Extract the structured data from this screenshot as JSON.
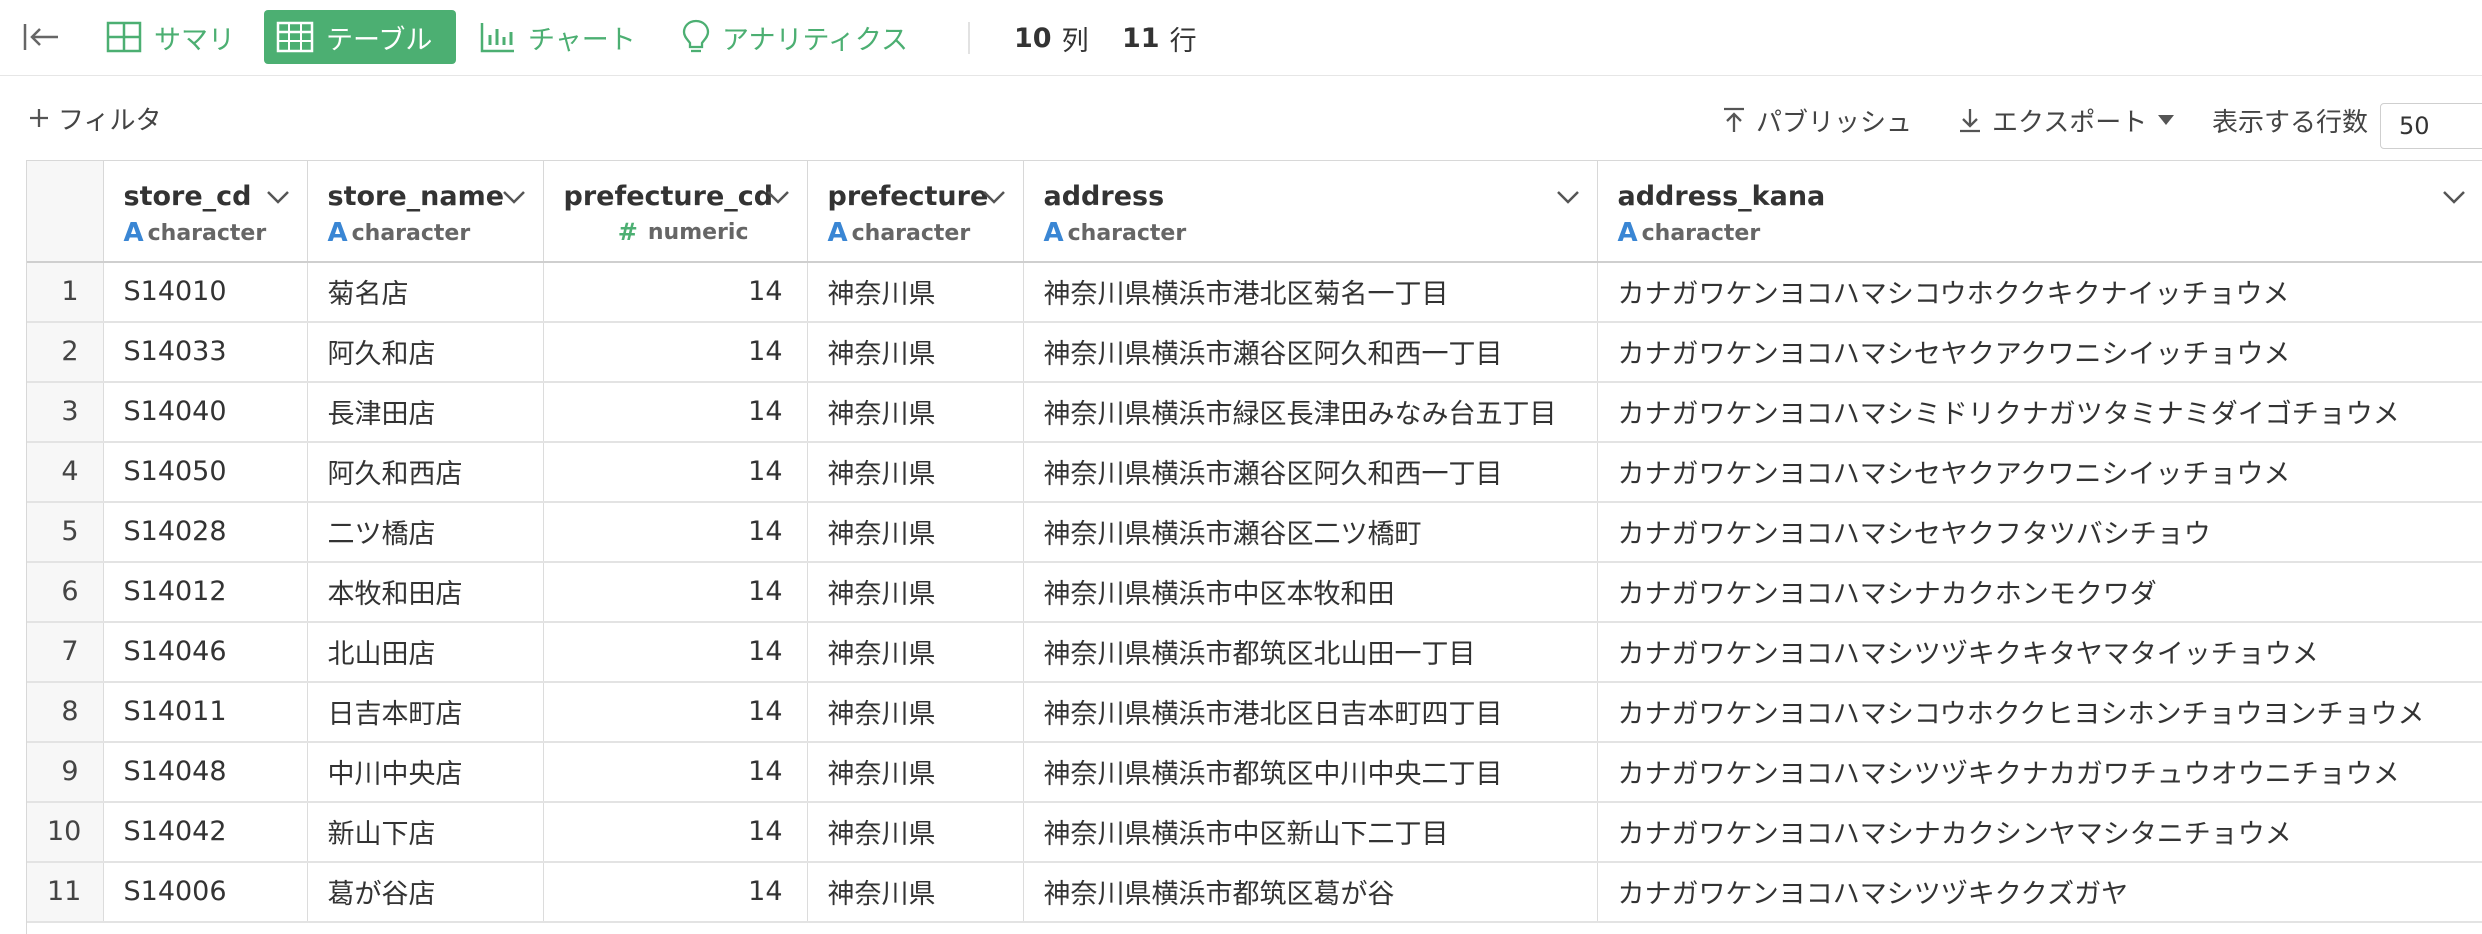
{
  "toolbar": {
    "tabs": [
      {
        "label": "サマリ",
        "icon": "grid-icon"
      },
      {
        "label": "テーブル",
        "icon": "table-icon",
        "active": true
      },
      {
        "label": "チャート",
        "icon": "bar-chart-icon"
      },
      {
        "label": "アナリティクス",
        "icon": "lightbulb-icon"
      }
    ],
    "columns_count": "10",
    "columns_unit": "列",
    "rows_count": "11",
    "rows_unit": "行"
  },
  "subbar": {
    "filter_label": "フィルタ",
    "publish_label": "パブリッシュ",
    "export_label": "エクスポート",
    "rows_display_label": "表示する行数",
    "rows_display_value": "50"
  },
  "table": {
    "columns": [
      {
        "name": "store_cd",
        "type": "character"
      },
      {
        "name": "store_name",
        "type": "character"
      },
      {
        "name": "prefecture_cd",
        "type": "numeric"
      },
      {
        "name": "prefecture",
        "type": "character"
      },
      {
        "name": "address",
        "type": "character"
      },
      {
        "name": "address_kana",
        "type": "character"
      }
    ],
    "rows": [
      {
        "idx": "1",
        "store_cd": "S14010",
        "store_name": "菊名店",
        "prefecture_cd": "14",
        "prefecture": "神奈川県",
        "address": "神奈川県横浜市港北区菊名一丁目",
        "address_kana": "カナガワケンヨコハマシコウホククキクナイッチョウメ"
      },
      {
        "idx": "2",
        "store_cd": "S14033",
        "store_name": "阿久和店",
        "prefecture_cd": "14",
        "prefecture": "神奈川県",
        "address": "神奈川県横浜市瀬谷区阿久和西一丁目",
        "address_kana": "カナガワケンヨコハマシセヤクアクワニシイッチョウメ"
      },
      {
        "idx": "3",
        "store_cd": "S14040",
        "store_name": "長津田店",
        "prefecture_cd": "14",
        "prefecture": "神奈川県",
        "address": "神奈川県横浜市緑区長津田みなみ台五丁目",
        "address_kana": "カナガワケンヨコハマシミドリクナガツタミナミダイゴチョウメ"
      },
      {
        "idx": "4",
        "store_cd": "S14050",
        "store_name": "阿久和西店",
        "prefecture_cd": "14",
        "prefecture": "神奈川県",
        "address": "神奈川県横浜市瀬谷区阿久和西一丁目",
        "address_kana": "カナガワケンヨコハマシセヤクアクワニシイッチョウメ"
      },
      {
        "idx": "5",
        "store_cd": "S14028",
        "store_name": "二ツ橋店",
        "prefecture_cd": "14",
        "prefecture": "神奈川県",
        "address": "神奈川県横浜市瀬谷区二ツ橋町",
        "address_kana": "カナガワケンヨコハマシセヤクフタツバシチョウ"
      },
      {
        "idx": "6",
        "store_cd": "S14012",
        "store_name": "本牧和田店",
        "prefecture_cd": "14",
        "prefecture": "神奈川県",
        "address": "神奈川県横浜市中区本牧和田",
        "address_kana": "カナガワケンヨコハマシナカクホンモクワダ"
      },
      {
        "idx": "7",
        "store_cd": "S14046",
        "store_name": "北山田店",
        "prefecture_cd": "14",
        "prefecture": "神奈川県",
        "address": "神奈川県横浜市都筑区北山田一丁目",
        "address_kana": "カナガワケンヨコハマシツヅキクキタヤマタイッチョウメ"
      },
      {
        "idx": "8",
        "store_cd": "S14011",
        "store_name": "日吉本町店",
        "prefecture_cd": "14",
        "prefecture": "神奈川県",
        "address": "神奈川県横浜市港北区日吉本町四丁目",
        "address_kana": "カナガワケンヨコハマシコウホククヒヨシホンチョウヨンチョウメ"
      },
      {
        "idx": "9",
        "store_cd": "S14048",
        "store_name": "中川中央店",
        "prefecture_cd": "14",
        "prefecture": "神奈川県",
        "address": "神奈川県横浜市都筑区中川中央二丁目",
        "address_kana": "カナガワケンヨコハマシツヅキクナカガワチュウオウニチョウメ"
      },
      {
        "idx": "10",
        "store_cd": "S14042",
        "store_name": "新山下店",
        "prefecture_cd": "14",
        "prefecture": "神奈川県",
        "address": "神奈川県横浜市中区新山下二丁目",
        "address_kana": "カナガワケンヨコハマシナカクシンヤマシタニチョウメ"
      },
      {
        "idx": "11",
        "store_cd": "S14006",
        "store_name": "葛が谷店",
        "prefecture_cd": "14",
        "prefecture": "神奈川県",
        "address": "神奈川県横浜市都筑区葛が谷",
        "address_kana": "カナガワケンヨコハマシツヅキククズガヤ"
      }
    ]
  },
  "colors": {
    "accent": "#4caf72",
    "type_character": "#3a86d4",
    "type_numeric": "#4caf72"
  }
}
